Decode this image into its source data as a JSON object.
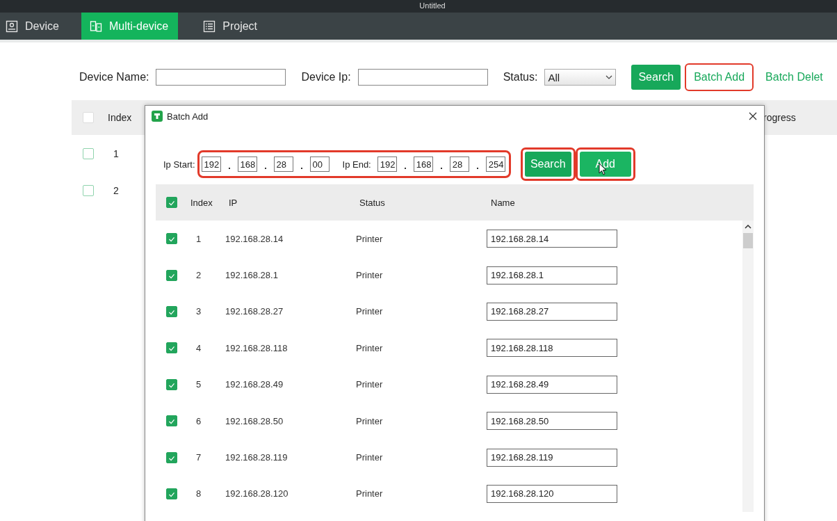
{
  "window": {
    "title": "Untitled"
  },
  "tabs": [
    {
      "label": "Device",
      "selected": false
    },
    {
      "label": "Multi-device",
      "selected": true
    },
    {
      "label": "Project",
      "selected": false
    }
  ],
  "filters": {
    "device_name_label": "Device Name:",
    "device_ip_label": "Device Ip:",
    "status_label": "Status:",
    "status_value": "All"
  },
  "toolbar": [
    {
      "label": "Search",
      "kind": "solid",
      "highlighted": false
    },
    {
      "label": "Batch Add",
      "kind": "link",
      "highlighted": true
    },
    {
      "label": "Batch Delet",
      "kind": "link",
      "highlighted": false
    }
  ],
  "table": {
    "columns": [
      "Index",
      "rogress"
    ],
    "all_checked": false,
    "rows": [
      {
        "index": "1",
        "checked": false
      },
      {
        "index": "2",
        "checked": false
      }
    ]
  },
  "dialog": {
    "title": "Batch Add",
    "ip_range": {
      "highlighted": true,
      "start_label": "Ip Start:",
      "start": [
        "192",
        "168",
        "28",
        "00"
      ],
      "end_label": "Ip End:",
      "end": [
        "192",
        "168",
        "28",
        "254"
      ]
    },
    "buttons": [
      {
        "label": "Search",
        "highlighted": true,
        "hovered": false
      },
      {
        "label": "Add",
        "highlighted": true,
        "hovered": true
      }
    ],
    "columns": [
      "Index",
      "IP",
      "Status",
      "Name"
    ],
    "all_checked": true,
    "rows": [
      {
        "index": "1",
        "ip": "192.168.28.14",
        "status": "Printer",
        "name": "192.168.28.14",
        "checked": true
      },
      {
        "index": "2",
        "ip": "192.168.28.1",
        "status": "Printer",
        "name": "192.168.28.1",
        "checked": true
      },
      {
        "index": "3",
        "ip": "192.168.28.27",
        "status": "Printer",
        "name": "192.168.28.27",
        "checked": true
      },
      {
        "index": "4",
        "ip": "192.168.28.118",
        "status": "Printer",
        "name": "192.168.28.118",
        "checked": true
      },
      {
        "index": "5",
        "ip": "192.168.28.49",
        "status": "Printer",
        "name": "192.168.28.49",
        "checked": true
      },
      {
        "index": "6",
        "ip": "192.168.28.50",
        "status": "Printer",
        "name": "192.168.28.50",
        "checked": true
      },
      {
        "index": "7",
        "ip": "192.168.28.119",
        "status": "Printer",
        "name": "192.168.28.119",
        "checked": true
      },
      {
        "index": "8",
        "ip": "192.168.28.120",
        "status": "Printer",
        "name": "192.168.28.120",
        "checked": true
      }
    ]
  }
}
